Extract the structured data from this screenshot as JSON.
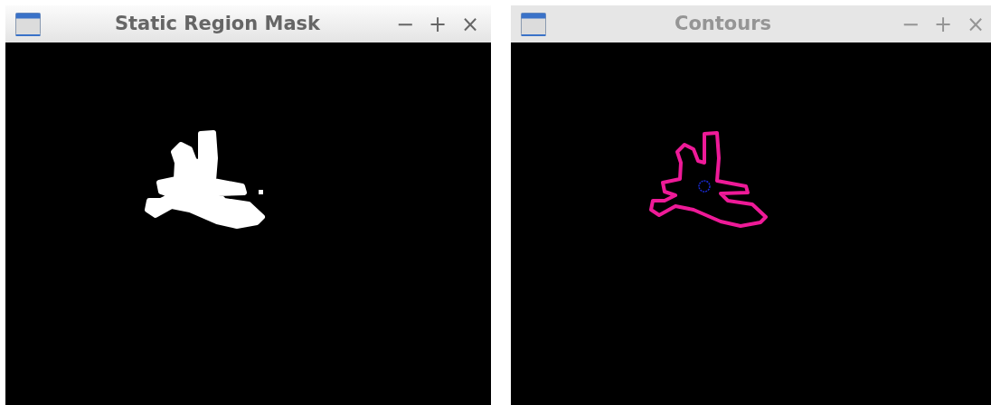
{
  "windows": [
    {
      "title": "Static Region Mask",
      "active": true,
      "controls": [
        "−",
        "+",
        "×"
      ],
      "content": {
        "kind": "mask"
      }
    },
    {
      "title": "Contours",
      "active": false,
      "controls": [
        "−",
        "+",
        "×"
      ],
      "content": {
        "kind": "contour"
      }
    }
  ]
}
